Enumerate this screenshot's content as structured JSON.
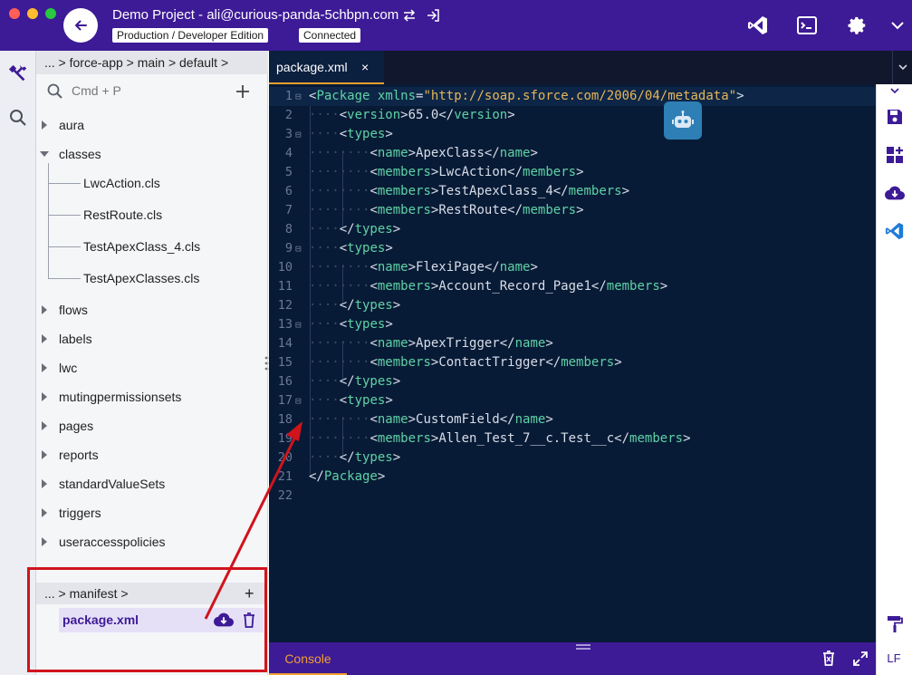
{
  "window": {
    "title": "Demo Project - ali@curious-panda-5chbpn.com",
    "edition_badge": "Production / Developer Edition",
    "status_badge": "Connected"
  },
  "explorer": {
    "breadcrumb": "... > force-app > main > default >",
    "search_placeholder": "Cmd + P",
    "folders": [
      {
        "label": "aura",
        "expanded": false
      },
      {
        "label": "classes",
        "expanded": true
      },
      {
        "label": "flows",
        "expanded": false
      },
      {
        "label": "labels",
        "expanded": false
      },
      {
        "label": "lwc",
        "expanded": false
      },
      {
        "label": "mutingpermissionsets",
        "expanded": false
      },
      {
        "label": "pages",
        "expanded": false
      },
      {
        "label": "reports",
        "expanded": false
      },
      {
        "label": "standardValueSets",
        "expanded": false
      },
      {
        "label": "triggers",
        "expanded": false
      },
      {
        "label": "useraccesspolicies",
        "expanded": false
      }
    ],
    "class_files": [
      "LwcAction.cls",
      "RestRoute.cls",
      "TestApexClass_4.cls",
      "TestApexClasses.cls"
    ]
  },
  "manifest": {
    "breadcrumb": "... > manifest >",
    "add_label": "+",
    "file": "package.xml"
  },
  "editor": {
    "tab_label": "package.xml",
    "tab_close": "×",
    "lines": [
      {
        "n": "1",
        "fold": true,
        "indent": 0,
        "code": "<Package xmlns=\"http://soap.sforce.com/2006/04/metadata\">"
      },
      {
        "n": "2",
        "fold": false,
        "indent": 1,
        "code": "<version>65.0</version>"
      },
      {
        "n": "3",
        "fold": true,
        "indent": 1,
        "code": "<types>"
      },
      {
        "n": "4",
        "fold": false,
        "indent": 2,
        "code": "<name>ApexClass</name>"
      },
      {
        "n": "5",
        "fold": false,
        "indent": 2,
        "code": "<members>LwcAction</members>"
      },
      {
        "n": "6",
        "fold": false,
        "indent": 2,
        "code": "<members>TestApexClass_4</members>"
      },
      {
        "n": "7",
        "fold": false,
        "indent": 2,
        "code": "<members>RestRoute</members>"
      },
      {
        "n": "8",
        "fold": false,
        "indent": 1,
        "code": "</types>"
      },
      {
        "n": "9",
        "fold": true,
        "indent": 1,
        "code": "<types>"
      },
      {
        "n": "10",
        "fold": false,
        "indent": 2,
        "code": "<name>FlexiPage</name>"
      },
      {
        "n": "11",
        "fold": false,
        "indent": 2,
        "code": "<members>Account_Record_Page1</members>"
      },
      {
        "n": "12",
        "fold": false,
        "indent": 1,
        "code": "</types>"
      },
      {
        "n": "13",
        "fold": true,
        "indent": 1,
        "code": "<types>"
      },
      {
        "n": "14",
        "fold": false,
        "indent": 2,
        "code": "<name>ApexTrigger</name>"
      },
      {
        "n": "15",
        "fold": false,
        "indent": 2,
        "code": "<members>ContactTrigger</members>"
      },
      {
        "n": "16",
        "fold": false,
        "indent": 1,
        "code": "</types>"
      },
      {
        "n": "17",
        "fold": true,
        "indent": 1,
        "code": "<types>"
      },
      {
        "n": "18",
        "fold": false,
        "indent": 2,
        "code": "<name>CustomField</name>"
      },
      {
        "n": "19",
        "fold": false,
        "indent": 2,
        "code": "<members>Allen_Test_7__c.Test__c</members>"
      },
      {
        "n": "20",
        "fold": false,
        "indent": 1,
        "code": "</types>"
      },
      {
        "n": "21",
        "fold": false,
        "indent": 0,
        "code": "</Package>"
      },
      {
        "n": "22",
        "fold": false,
        "indent": 0,
        "code": ""
      }
    ]
  },
  "bottom": {
    "console_label": "Console",
    "line_ending": "LF"
  },
  "icons": {
    "back": "arrow-left-icon",
    "swap": "swap-icon",
    "logout": "login-icon",
    "vscode": "vscode-icon",
    "terminal": "terminal-icon",
    "settings": "gear-icon",
    "menu": "chevron-down-icon"
  },
  "colors": {
    "brand": "#3d1a96",
    "accent": "#f0a030",
    "editor_bg": "#081b36",
    "annotation": "#d0141c"
  }
}
